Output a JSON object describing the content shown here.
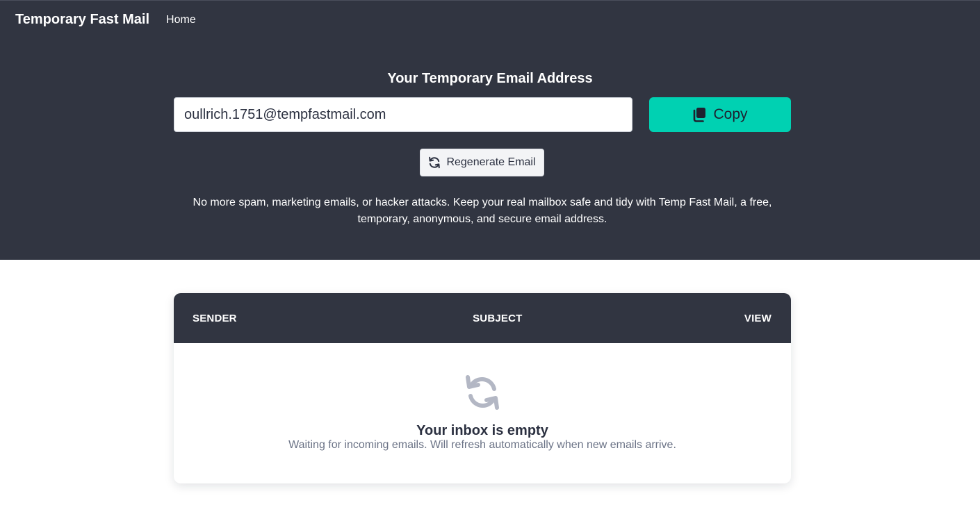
{
  "navbar": {
    "brand": "Temporary Fast Mail",
    "links": [
      {
        "label": "Home"
      }
    ]
  },
  "hero": {
    "title": "Your Temporary Email Address",
    "email_value": "oullrich.1751@tempfastmail.com",
    "copy_label": "Copy",
    "copy_icon": "copy-icon",
    "regenerate_label": "Regenerate Email",
    "regenerate_icon": "refresh-icon",
    "tagline": "No more spam, marketing emails, or hacker attacks. Keep your real mailbox safe and tidy with Temp Fast Mail, a free, temporary, anonymous, and secure email address."
  },
  "inbox": {
    "columns": [
      "SENDER",
      "SUBJECT",
      "VIEW"
    ],
    "empty_icon": "sync-icon",
    "empty_title": "Your inbox is empty",
    "empty_subtitle": "Waiting for incoming emails. Will refresh automatically when new emails arrive."
  },
  "colors": {
    "dark_bg": "#313541",
    "accent": "#00d1b2",
    "muted_icon": "#b3b7c4"
  }
}
